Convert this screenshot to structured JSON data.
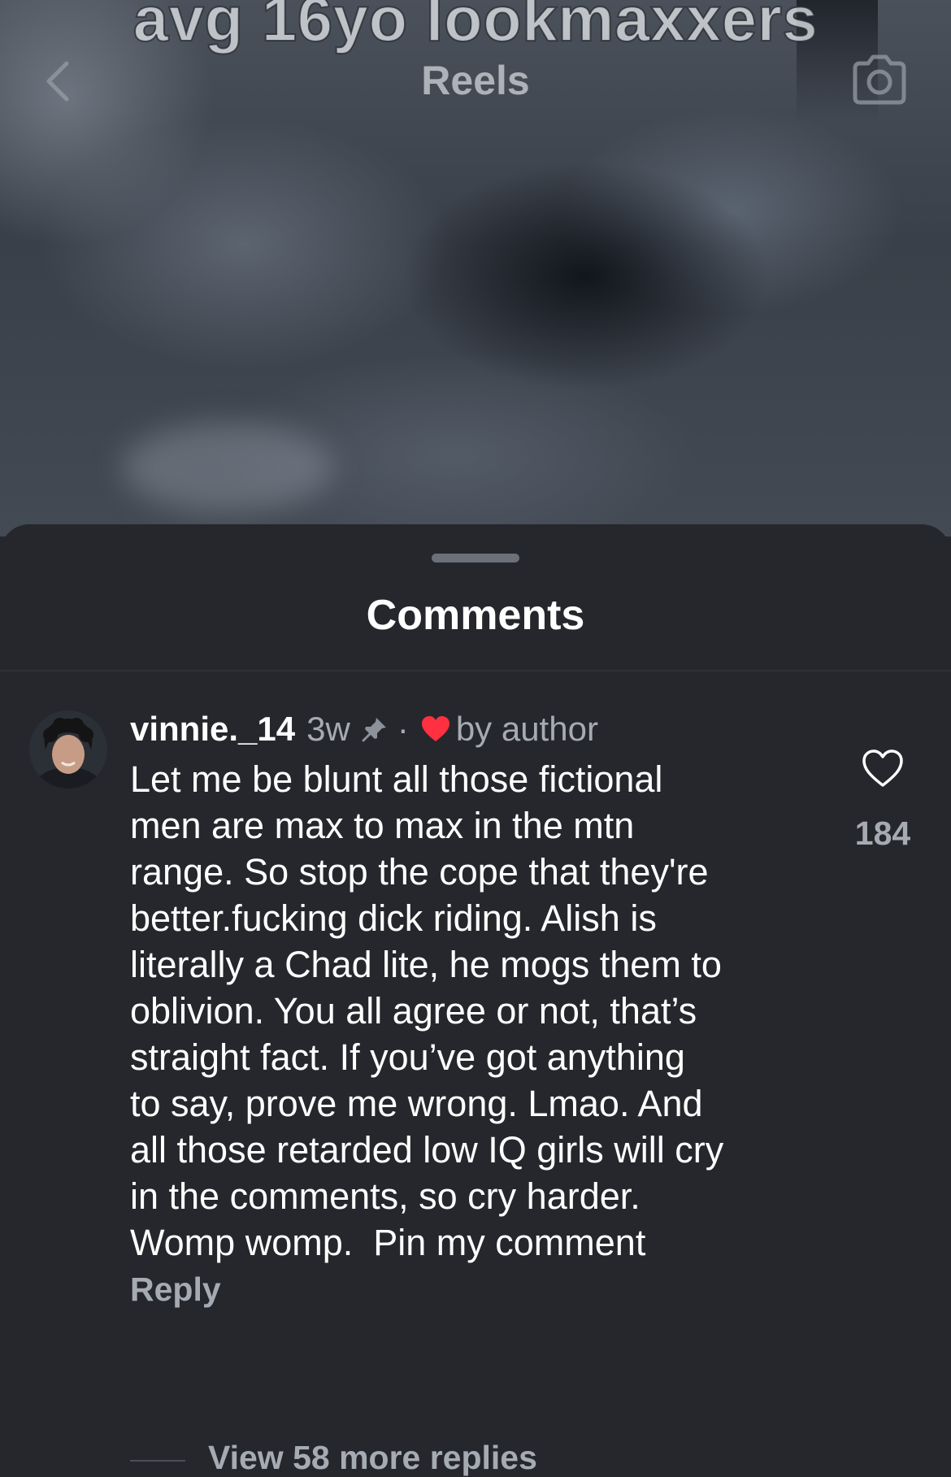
{
  "video": {
    "overlay_caption": "avg 16yo lookmaxxers",
    "title": "Reels",
    "back_icon": "chevron-left-icon",
    "camera_icon": "camera-icon"
  },
  "sheet": {
    "title": "Comments"
  },
  "comment": {
    "username": "vinnie._14",
    "time": "3w",
    "pinned_icon": "pin-icon",
    "separator": "·",
    "liked_by_author_icon": "heart-filled-icon",
    "liked_by_author_label": "by author",
    "text": "Let me be blunt all those fictional\nmen are max to max in the mtn\nrange. So stop the cope that they're\nbetter.fucking dick riding. Alish is\nliterally a Chad lite, he mogs them to\noblivion. You all agree or not, that’s\nstraight fact. If you’ve got anything\nto say, prove me wrong. Lmao. And\nall those retarded low IQ girls will cry\nin the comments, so cry harder.\nWomp womp.  Pin my comment",
    "like_count": "184",
    "reply_label": "Reply",
    "view_replies_label": "View 58 more replies"
  },
  "colors": {
    "sheet_bg": "#25272c",
    "secondary_text": "#a6abb3",
    "author_heart": "#ff3040"
  }
}
